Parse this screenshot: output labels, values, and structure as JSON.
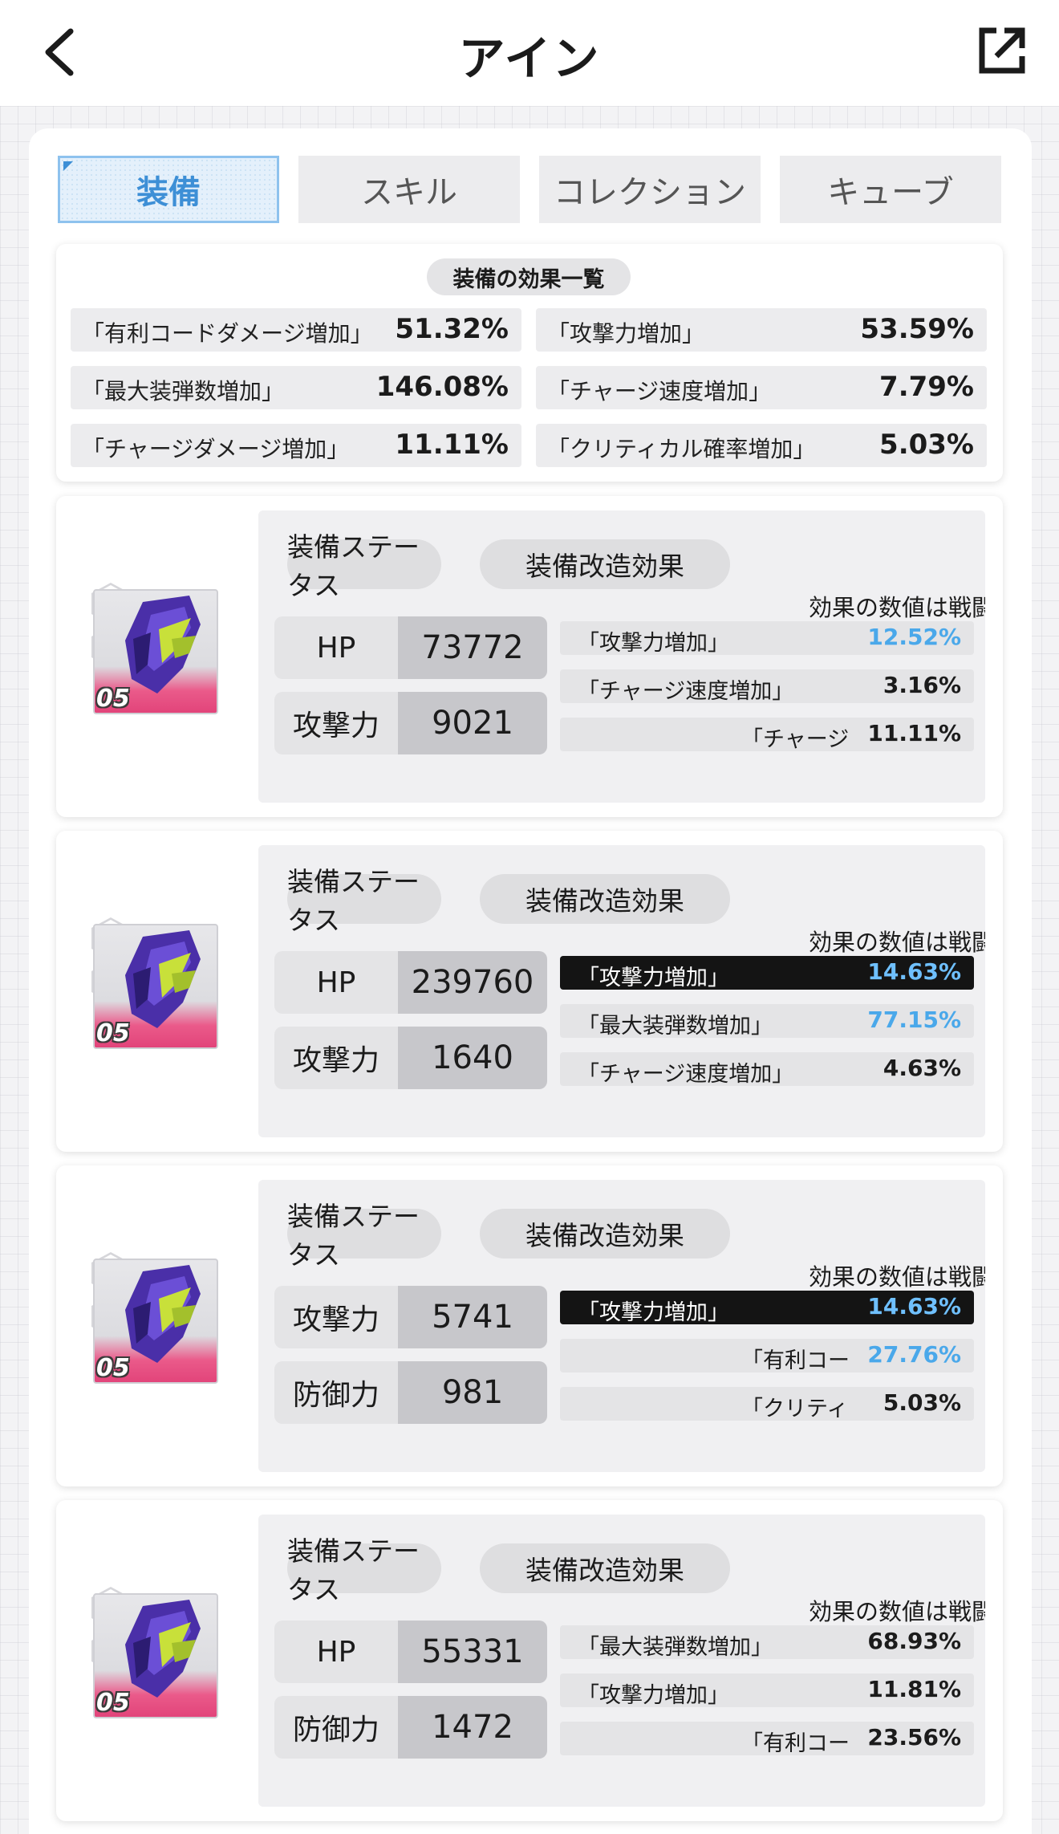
{
  "header": {
    "title": "アイン",
    "back_icon": "chevron-left-icon",
    "share_icon": "external-link-icon"
  },
  "tabs": [
    {
      "label": "装備",
      "active": true
    },
    {
      "label": "スキル",
      "active": false
    },
    {
      "label": "コレクション",
      "active": false
    },
    {
      "label": "キューブ",
      "active": false
    }
  ],
  "summary": {
    "title": "装備の効果一覧",
    "items": [
      {
        "label": "「有利コードダメージ増加」",
        "value": "51.32%"
      },
      {
        "label": "「攻撃力増加」",
        "value": "53.59%"
      },
      {
        "label": "「最大装弾数増加」",
        "value": "146.08%"
      },
      {
        "label": "「チャージ速度増加」",
        "value": "7.79%"
      },
      {
        "label": "「チャージダメージ増加」",
        "value": "11.11%"
      },
      {
        "label": "「クリティカル確率増加」",
        "value": "5.03%"
      }
    ]
  },
  "colors": {
    "highlight_blue": "#4aa8ea",
    "tier_pink": "#e2447a",
    "active_tab_blue": "#3d8fd6"
  },
  "equipment": [
    {
      "tier": "05",
      "status_title": "装備ステータス",
      "effect_title": "装備改造効果",
      "effect_note": "効果の数値は戦闘",
      "stats": [
        {
          "label": "HP",
          "value": "73772"
        },
        {
          "label": "攻撃力",
          "value": "9021"
        }
      ],
      "effects": [
        {
          "label": "「攻撃力増加」",
          "value": "12.52%",
          "highlight": true,
          "dark": false,
          "truncated": false
        },
        {
          "label": "「チャージ速度増加」",
          "value": "3.16%",
          "highlight": false,
          "dark": false,
          "truncated": false
        },
        {
          "label": "「チャージ",
          "value": "11.11%",
          "highlight": false,
          "dark": false,
          "truncated": true
        }
      ]
    },
    {
      "tier": "05",
      "status_title": "装備ステータス",
      "effect_title": "装備改造効果",
      "effect_note": "効果の数値は戦闘",
      "stats": [
        {
          "label": "HP",
          "value": "239760"
        },
        {
          "label": "攻撃力",
          "value": "1640"
        }
      ],
      "effects": [
        {
          "label": "「攻撃力増加」",
          "value": "14.63%",
          "highlight": true,
          "dark": true,
          "truncated": false
        },
        {
          "label": "「最大装弾数増加」",
          "value": "77.15%",
          "highlight": true,
          "dark": false,
          "truncated": false
        },
        {
          "label": "「チャージ速度増加」",
          "value": "4.63%",
          "highlight": false,
          "dark": false,
          "truncated": false
        }
      ]
    },
    {
      "tier": "05",
      "status_title": "装備ステータス",
      "effect_title": "装備改造効果",
      "effect_note": "効果の数値は戦闘",
      "stats": [
        {
          "label": "攻撃力",
          "value": "5741"
        },
        {
          "label": "防御力",
          "value": "981"
        }
      ],
      "effects": [
        {
          "label": "「攻撃力増加」",
          "value": "14.63%",
          "highlight": true,
          "dark": true,
          "truncated": false
        },
        {
          "label": "「有利コー",
          "value": "27.76%",
          "highlight": true,
          "dark": false,
          "truncated": true
        },
        {
          "label": "「クリティ",
          "value": "5.03%",
          "highlight": false,
          "dark": false,
          "truncated": true
        }
      ]
    },
    {
      "tier": "05",
      "status_title": "装備ステータス",
      "effect_title": "装備改造効果",
      "effect_note": "効果の数値は戦闘",
      "stats": [
        {
          "label": "HP",
          "value": "55331"
        },
        {
          "label": "防御力",
          "value": "1472"
        }
      ],
      "effects": [
        {
          "label": "「最大装弾数増加」",
          "value": "68.93%",
          "highlight": false,
          "dark": false,
          "truncated": false
        },
        {
          "label": "「攻撃力増加」",
          "value": "11.81%",
          "highlight": false,
          "dark": false,
          "truncated": false
        },
        {
          "label": "「有利コー",
          "value": "23.56%",
          "highlight": false,
          "dark": false,
          "truncated": true
        }
      ]
    }
  ]
}
